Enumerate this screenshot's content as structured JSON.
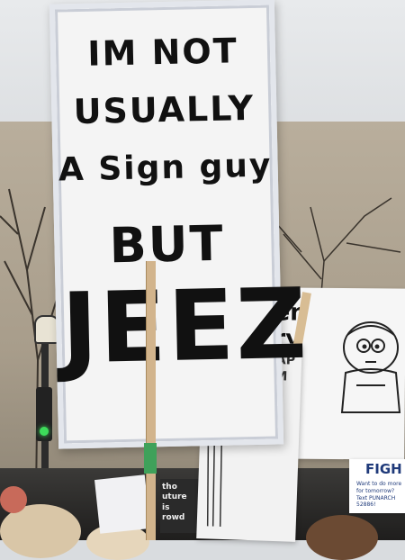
{
  "main_sign": {
    "line1": "IM NOT",
    "line2": "USUALLY",
    "line3": "A Sign guy",
    "line4": "BUT",
    "line5": "JEEZ"
  },
  "right_sign": {
    "text_line1": "en",
    "text_line2": "ry"
  },
  "mid_sign": {
    "text_line1": "NAP",
    "text_line2": "AM"
  },
  "fight_sign": {
    "title": "FIGH",
    "subtitle": "Want to do more for tomorrow? Text PUNARCH 52886!"
  },
  "small_sign": {
    "line1": "tho",
    "line2": "uture",
    "line3": "is",
    "line4": "rowd"
  },
  "colors": {
    "sky": "#e2e4e7",
    "building": "#ada290",
    "sign_paper": "#f4f4f4",
    "ink": "#111111",
    "signal_green": "#3ddc5a"
  }
}
